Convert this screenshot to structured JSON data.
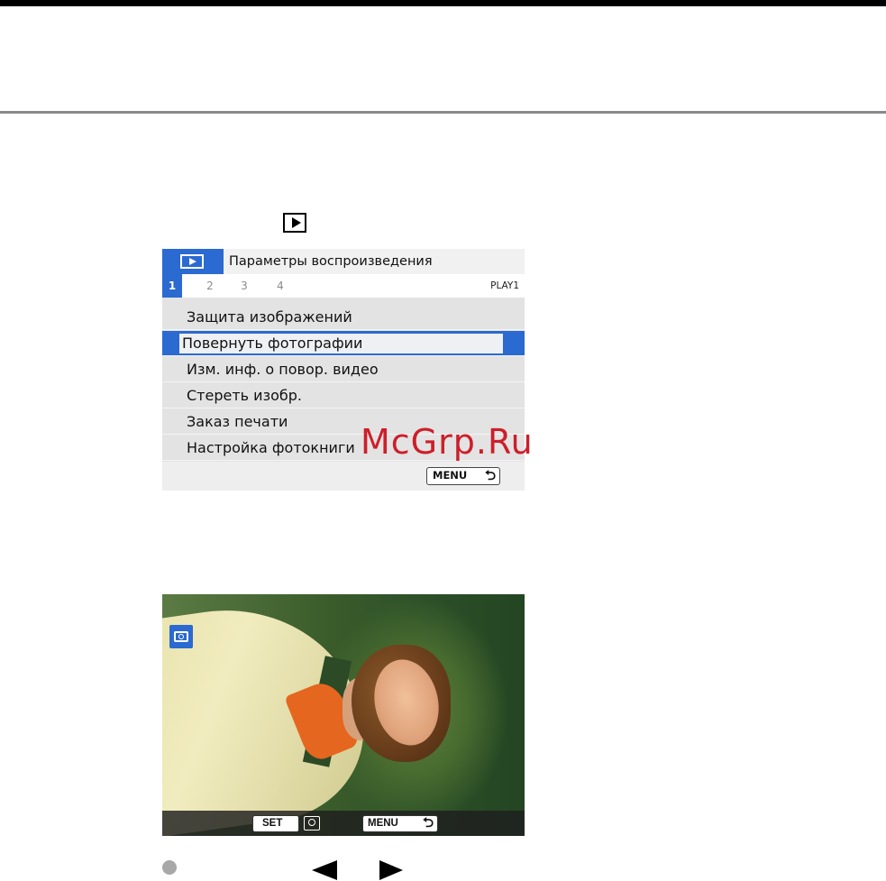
{
  "menu_screen": {
    "title": "Параметры воспроизведения",
    "tabs": [
      "1",
      "2",
      "3",
      "4"
    ],
    "active_tab": "1",
    "page_label": "PLAY1",
    "items": [
      "Защита изображений",
      "Повернуть фотографии",
      "Изм. инф. о повор. видео",
      "Стереть изобр.",
      "Заказ печати",
      "Настройка фотокниги"
    ],
    "selected_index": 1,
    "menu_button": "MENU",
    "return_glyph": "⮌"
  },
  "watermark": "McGrp.Ru",
  "photo_screen": {
    "set_button": "SET",
    "menu_button": "MENU",
    "return_glyph": "⮌"
  },
  "colors": {
    "accent": "#2a6ad1",
    "watermark": "#cc1f2a"
  },
  "icons": [
    "playback-icon",
    "rotate-icon",
    "bullet-icon",
    "arrow-left-icon",
    "arrow-right-icon"
  ]
}
